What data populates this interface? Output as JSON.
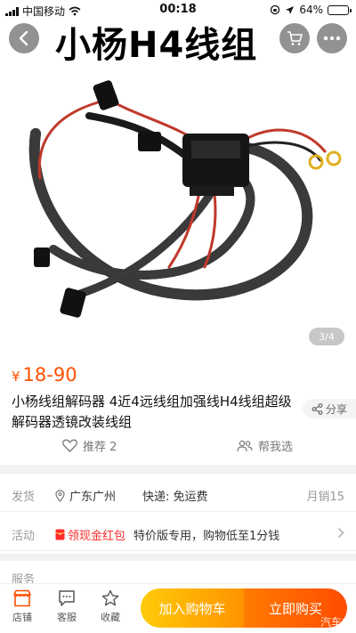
{
  "status_bar": {
    "carrier": "中国移动",
    "time": "00:18",
    "battery": "64%",
    "battery_level": 0.64
  },
  "header": {
    "overlay_title": "小杨H4线组"
  },
  "gallery": {
    "counter": "3/4"
  },
  "product": {
    "currency": "¥",
    "price": "18-90",
    "title": "小杨线组解码器  4近4远线组加强线H4线组超级解码器透镜改装线组",
    "share_label": "分享",
    "recommend_label": "推荐 2",
    "help_choose_label": "帮我选"
  },
  "shipping": {
    "label": "发货",
    "location": "广东广州",
    "fee": "快递: 免运费",
    "monthly_sales": "月销15"
  },
  "promotion": {
    "label": "活动",
    "tag": "领现金红包",
    "text": "特价版专用，购物低至1分钱"
  },
  "service": {
    "label": "服务"
  },
  "bottom_bar": {
    "store": "店铺",
    "customer_service": "客服",
    "favorite": "收藏",
    "add_to_cart": "加入购物车",
    "buy_now": "立即购买",
    "watermark": "汽车之"
  },
  "colors": {
    "price": "#ff5000",
    "cart_button": "#ffb000",
    "buy_button": "#ff5a00",
    "promo_red": "#ff2a2a"
  }
}
